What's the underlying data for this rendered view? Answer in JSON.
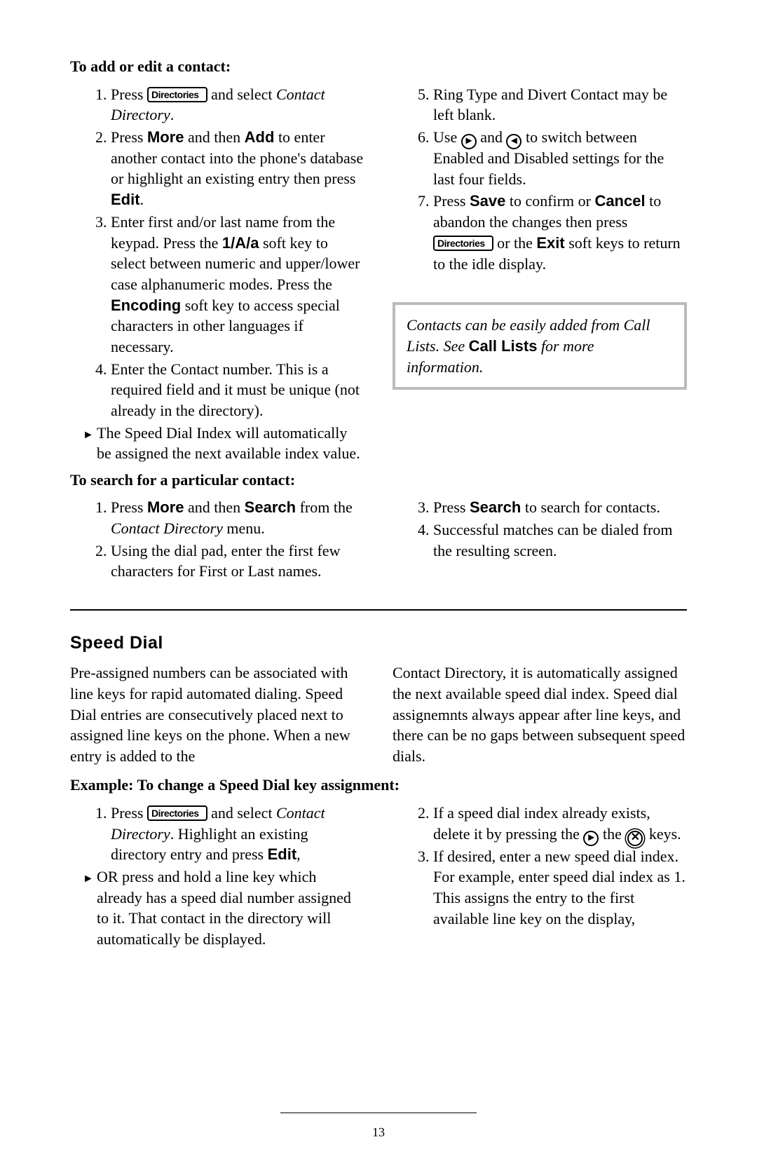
{
  "page_number": "13",
  "section1": {
    "heading": "To add or edit a contact:",
    "btn_label": "Directories",
    "steps_left": {
      "s1a": "Press ",
      "s1b": " and select ",
      "s1c_it": "Contact Directory",
      "s1d": ".",
      "s2a": "Press ",
      "s2_more": "More",
      "s2b": " and then ",
      "s2_add": "Add",
      "s2c": " to enter another contact into the phone's database or highlight an existing entry then press ",
      "s2_edit": "Edit",
      "s2d": ".",
      "s3a": "Enter first and/or last name from the keypad.  Press the ",
      "s3_key": "1/A/a",
      "s3b": " soft key to select between numeric and upper/lower case alphanumeric modes. Press the ",
      "s3_enc": "Encoding",
      "s3c": " soft key to access special characters in other languages if necessary.",
      "s4": "Enter the Contact number.  This is a required field and it must be unique (not already in the directory).",
      "arrow": "The Speed Dial Index will automatically be assigned the next available index value."
    },
    "steps_right": {
      "s5": "Ring Type and Divert Contact may be left blank.",
      "s6a": "Use ",
      "s6b": " and ",
      "s6c": " to switch between Enabled and Disabled settings for the last four fields.",
      "s7a": "Press ",
      "s7_save": "Save",
      "s7b": " to confirm or ",
      "s7_cancel": "Cancel",
      "s7c": " to abandon the changes then press ",
      "s7d": " or the ",
      "s7_exit": "Exit",
      "s7e": " soft keys to return to the idle display."
    },
    "tip": {
      "a": "Contacts can be easily added from Call Lists.  See ",
      "b": "Call Lists",
      "c": " for more information."
    }
  },
  "section2": {
    "heading": "To search for a particular contact:",
    "left": {
      "s1a": "Press ",
      "s1_more": "More",
      "s1b": " and then ",
      "s1_search": "Search",
      "s1c": " from the ",
      "s1d_it": "Contact Directory",
      "s1e": " menu.",
      "s2": "Using the dial pad, enter the first few characters for First or Last names."
    },
    "right": {
      "s3a": "Press ",
      "s3_search": "Search",
      "s3b": " to search for contacts.",
      "s4": "Successful matches can be dialed from the resulting screen."
    }
  },
  "section3": {
    "title": "Speed Dial",
    "body_left": "Pre-assigned numbers can be associated with line keys for rapid automated dialing.  Speed Dial entries are consecutively placed next to assigned line keys on the phone.  When a new entry is added to the",
    "body_right": "Contact Directory, it is automatically assigned the next available speed dial index. Speed dial assignemnts always appear after line keys, and there can be no gaps between subsequent speed dials."
  },
  "section4": {
    "heading": "Example: To change a Speed Dial key assignment:",
    "left": {
      "s1a": "Press ",
      "s1b": " and select ",
      "s1c_it": "Contact Directory",
      "s1d": ".  Highlight an existing directory entry and press ",
      "s1_edit": "Edit",
      "s1e": ",",
      "arrow": "OR press and hold a line key which already has a speed dial number assigned to it.  That contact in the directory will automatically be displayed."
    },
    "right": {
      "s2a": "If a speed dial index already exists, delete it by pressing the ",
      "s2b": " the ",
      "s2c": " keys.",
      "s3": "If desired, enter a new speed dial index.  For example, enter speed dial index as 1.  This assigns the entry to the first available line key on the display,"
    }
  }
}
